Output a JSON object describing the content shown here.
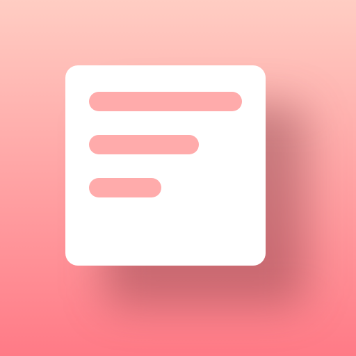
{
  "icon": {
    "name": "notes-app-icon",
    "glyph": "document-lines-icon",
    "colors": {
      "background_top": "#ffcdc3",
      "background_bottom": "#ff7a86",
      "card": "#ffffff",
      "line": "#ffabab"
    }
  }
}
